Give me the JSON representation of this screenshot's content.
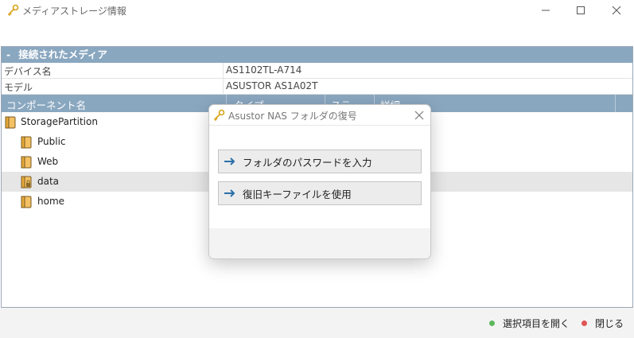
{
  "window": {
    "title": "メディアストレージ情報"
  },
  "section": {
    "toggle": "-",
    "title": "接続されたメディア"
  },
  "info": {
    "device_label": "デバイス名",
    "device_value": "AS1102TL-A714",
    "model_label": "モデル",
    "model_value": "ASUSTOR AS1A02T"
  },
  "columns": {
    "component": "コンポーネント名",
    "type": "タイプ",
    "status": "ステ",
    "detail": "詳細"
  },
  "tree": [
    {
      "label": "StoragePartition",
      "icon": "folder-icon"
    },
    {
      "label": "Public",
      "icon": "folder-icon"
    },
    {
      "label": "Web",
      "icon": "folder-icon"
    },
    {
      "label": "data",
      "icon": "locked-folder-icon"
    },
    {
      "label": "home",
      "icon": "folder-icon"
    }
  ],
  "footer": {
    "open_label": "選択項目を開く",
    "close_label": "閉じる"
  },
  "dialog": {
    "title": "Asustor NAS フォルダの復号",
    "option1": "フォルダのパスワードを入力",
    "option2": "復旧キーファイルを使用"
  },
  "colors": {
    "header_bg": "#8aa7c0",
    "arrow": "#2a6fa8",
    "green": "#5cb85c",
    "red": "#e05555"
  }
}
